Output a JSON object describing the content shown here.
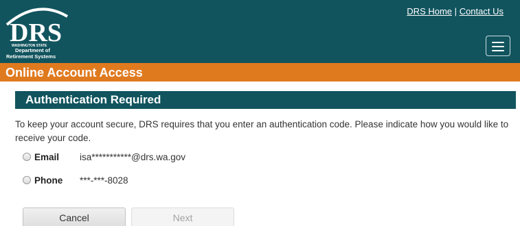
{
  "header": {
    "logo": {
      "letters": "DRS",
      "line1": "WASHINGTON STATE",
      "line2": "Department of",
      "line3": "Retirement Systems"
    },
    "links": {
      "home": "DRS Home",
      "separator": "|",
      "contact": "Contact Us"
    },
    "menu_icon": "hamburger-icon"
  },
  "banner": {
    "title": "Online Account Access"
  },
  "section": {
    "title": "Authentication Required"
  },
  "instructions": "To keep your account secure, DRS requires that you enter an authentication code. Please indicate how you would like to receive your code.",
  "options": [
    {
      "label": "Email",
      "value": "isa***********@drs.wa.gov",
      "selected": false
    },
    {
      "label": "Phone",
      "value": "***-***-8028",
      "selected": false
    }
  ],
  "buttons": {
    "cancel": "Cancel",
    "next": "Next"
  },
  "colors": {
    "header_bg": "#11545e",
    "banner_bg": "#e07a1f",
    "text": "#333333"
  }
}
